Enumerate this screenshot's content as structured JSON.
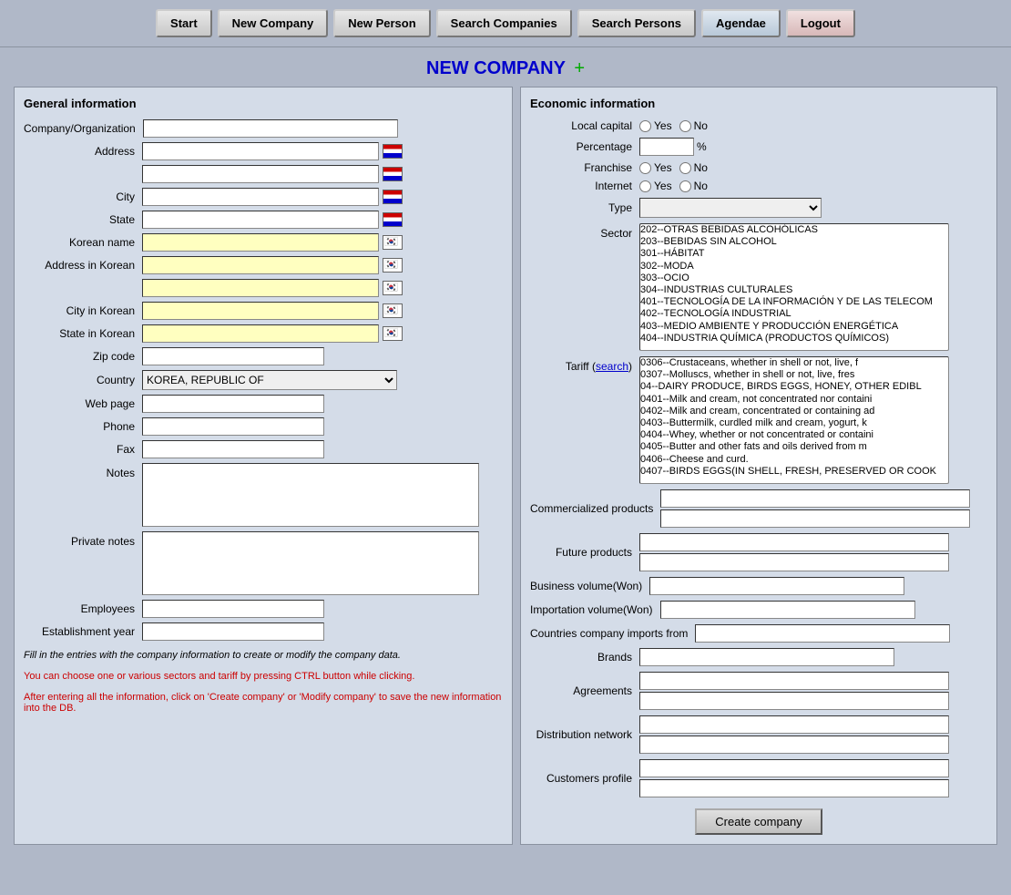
{
  "navbar": {
    "start_label": "Start",
    "new_company_label": "New Company",
    "new_person_label": "New Person",
    "search_companies_label": "Search Companies",
    "search_persons_label": "Search Persons",
    "agendae_label": "Agendae",
    "logout_label": "Logout"
  },
  "page_title": "NEW COMPANY",
  "page_title_icon": "+",
  "general": {
    "section_title": "General information",
    "fields": {
      "company_label": "Company/Organization",
      "address_label": "Address",
      "city_label": "City",
      "state_label": "State",
      "korean_name_label": "Korean name",
      "address_korean_label": "Address in Korean",
      "city_korean_label": "City in Korean",
      "state_korean_label": "State in Korean",
      "zip_label": "Zip code",
      "country_label": "Country",
      "country_value": "KOREA, REPUBLIC OF",
      "webpage_label": "Web page",
      "phone_label": "Phone",
      "fax_label": "Fax",
      "notes_label": "Notes",
      "private_notes_label": "Private notes",
      "employees_label": "Employees",
      "establishment_label": "Establishment year"
    }
  },
  "economic": {
    "section_title": "Economic information",
    "local_capital_label": "Local capital",
    "yes_label": "Yes",
    "no_label": "No",
    "percentage_label": "Percentage",
    "pct_symbol": "%",
    "franchise_label": "Franchise",
    "internet_label": "Internet",
    "type_label": "Type",
    "sector_label": "Sector",
    "tariff_label": "Tariff",
    "tariff_link": "search",
    "commercialized_label": "Commercialized products",
    "future_label": "Future products",
    "business_volume_label": "Business volume(Won)",
    "importation_volume_label": "Importation volume(Won)",
    "countries_imports_label": "Countries company imports from",
    "brands_label": "Brands",
    "agreements_label": "Agreements",
    "distribution_label": "Distribution network",
    "customers_label": "Customers profile",
    "sector_options": [
      "202--OTRAS BEBIDAS ALCOHÓLICAS",
      "203--BEBIDAS SIN ALCOHOL",
      "301--HÁBITAT",
      "302--MODA",
      "303--OCIO",
      "304--INDUSTRIAS CULTURALES",
      "401--TECNOLOGÍA DE LA INFORMACIÓN Y DE LAS TELECOM",
      "402--TECNOLOGÍA INDUSTRIAL",
      "403--MEDIO AMBIENTE Y PRODUCCIÓN ENERGÉTICA",
      "404--INDUSTRIA QUÍMICA (PRODUCTOS QUÍMICOS)"
    ],
    "tariff_options": [
      "0306--Crustaceans, whether in shell or not, live, f",
      "0307--Molluscs, whether in shell or not, live, fres",
      "04--DAIRY PRODUCE, BIRDS EGGS, HONEY, OTHER EDIBL",
      "0401--Milk and cream, not concentrated nor containi",
      "0402--Milk and cream, concentrated or containing ad",
      "0403--Buttermilk, curdled milk and cream, yogurt, k",
      "0404--Whey, whether or not concentrated or containi",
      "0405--Butter and other fats and oils derived from m",
      "0406--Cheese and curd.",
      "0407--BIRDS EGGS(IN SHELL, FRESH, PRESERVED OR COOK"
    ]
  },
  "info": {
    "fill_text": "Fill in the entries with the company information to create or modify the company data.",
    "ctrl_text": "You can choose one or various sectors and tariff by pressing CTRL button while clicking.",
    "after_text": "After entering all the information, click on 'Create company' or 'Modify company' to save the new information into the DB."
  },
  "create_btn_label": "Create company"
}
